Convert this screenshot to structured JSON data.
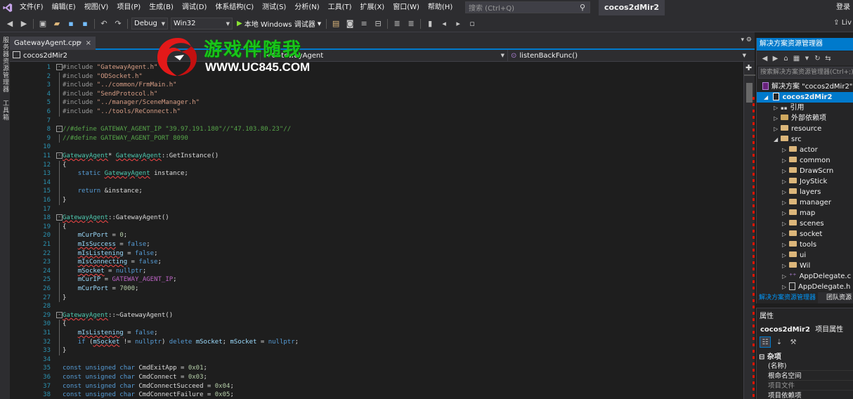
{
  "menubar": {
    "items": [
      "文件(F)",
      "编辑(E)",
      "视图(V)",
      "项目(P)",
      "生成(B)",
      "调试(D)",
      "体系结构(C)",
      "测试(S)",
      "分析(N)",
      "工具(T)",
      "扩展(X)",
      "窗口(W)",
      "帮助(H)"
    ],
    "search_placeholder": "搜索 (Ctrl+Q)",
    "window_title": "cocos2dMir2",
    "login": "登录"
  },
  "toolbar": {
    "config": "Debug",
    "platform": "Win32",
    "run_label": "本地 Windows 调试器",
    "live_share": "Liv"
  },
  "left_strip": {
    "tab1": "服务器资源管理器",
    "tab2": "工具箱"
  },
  "editor": {
    "tab_label": "GatewayAgent.cpp",
    "pin": "⊸",
    "close": "×",
    "nav_project": "cocos2dMir2",
    "nav_scope": "GatewayAgent",
    "nav_member": "listenBackFunc()",
    "lines": [
      {
        "n": "1",
        "fold": "-",
        "parts": [
          [
            "pp",
            "#include "
          ],
          [
            "str",
            "\"GatewayAgent.h\""
          ]
        ]
      },
      {
        "n": "2",
        "guide": true,
        "parts": [
          [
            "pp",
            "#include "
          ],
          [
            "str",
            "\"ODSocket.h\""
          ]
        ]
      },
      {
        "n": "3",
        "guide": true,
        "parts": [
          [
            "pp",
            "#include "
          ],
          [
            "str",
            "\"../common/FrmMain.h\""
          ]
        ]
      },
      {
        "n": "4",
        "guide": true,
        "parts": [
          [
            "pp",
            "#include "
          ],
          [
            "str",
            "\"SendProtocol.h\""
          ]
        ]
      },
      {
        "n": "5",
        "guide": true,
        "parts": [
          [
            "pp",
            "#include "
          ],
          [
            "str",
            "\"../manager/SceneManager.h\""
          ]
        ]
      },
      {
        "n": "6",
        "guide": true,
        "parts": [
          [
            "pp",
            "#include "
          ],
          [
            "str",
            "\"../tools/ReConnect.h\""
          ]
        ]
      },
      {
        "n": "7",
        "parts": []
      },
      {
        "n": "8",
        "fold": "-",
        "parts": [
          [
            "cm",
            "//#define GATEWAY_AGENT_IP \"39.97.191.180\"//\"47.103.80.23\"//"
          ]
        ]
      },
      {
        "n": "9",
        "guide": true,
        "parts": [
          [
            "cm",
            "//#define GATEWAY_AGENT_PORT 8090"
          ]
        ]
      },
      {
        "n": "10",
        "parts": []
      },
      {
        "n": "11",
        "fold": "-",
        "parts": [
          [
            "ty sq",
            "GatewayAgent"
          ],
          [
            "",
            "* "
          ],
          [
            "ty sq",
            "GatewayAgent"
          ],
          [
            "",
            "::GetInstance()"
          ]
        ]
      },
      {
        "n": "12",
        "guide": true,
        "parts": [
          [
            "",
            "{"
          ]
        ]
      },
      {
        "n": "13",
        "guide": true,
        "parts": [
          [
            "",
            "    "
          ],
          [
            "kw",
            "static "
          ],
          [
            "ty sq",
            "GatewayAgent"
          ],
          [
            "",
            " instance;"
          ]
        ]
      },
      {
        "n": "14",
        "guide": true,
        "parts": []
      },
      {
        "n": "15",
        "guide": true,
        "parts": [
          [
            "",
            "    "
          ],
          [
            "kw",
            "return "
          ],
          [
            "",
            "&instance;"
          ]
        ]
      },
      {
        "n": "16",
        "guide": true,
        "parts": [
          [
            "",
            "}"
          ]
        ]
      },
      {
        "n": "17",
        "parts": []
      },
      {
        "n": "18",
        "fold": "-",
        "parts": [
          [
            "ty sq",
            "GatewayAgent"
          ],
          [
            "",
            "::GatewayAgent()"
          ]
        ]
      },
      {
        "n": "19",
        "guide": true,
        "parts": [
          [
            "",
            "{"
          ]
        ]
      },
      {
        "n": "20",
        "guide": true,
        "parts": [
          [
            "",
            "    "
          ],
          [
            "vr",
            "mCurPort"
          ],
          [
            "",
            " = "
          ],
          [
            "num",
            "0"
          ],
          [
            "",
            ";"
          ]
        ]
      },
      {
        "n": "21",
        "guide": true,
        "parts": [
          [
            "",
            "    "
          ],
          [
            "vr sq",
            "mIsSuccess"
          ],
          [
            "",
            " = "
          ],
          [
            "kw",
            "false"
          ],
          [
            "",
            ";"
          ]
        ]
      },
      {
        "n": "22",
        "guide": true,
        "parts": [
          [
            "",
            "    "
          ],
          [
            "vr sq",
            "mIsListening"
          ],
          [
            "",
            " = "
          ],
          [
            "kw",
            "false"
          ],
          [
            "",
            ";"
          ]
        ]
      },
      {
        "n": "23",
        "guide": true,
        "parts": [
          [
            "",
            "    "
          ],
          [
            "vr sq",
            "mIsConnecting"
          ],
          [
            "",
            " = "
          ],
          [
            "kw",
            "false"
          ],
          [
            "",
            ";"
          ]
        ]
      },
      {
        "n": "24",
        "guide": true,
        "parts": [
          [
            "",
            "    "
          ],
          [
            "vr sq",
            "mSocket"
          ],
          [
            "",
            " = "
          ],
          [
            "kw",
            "nullptr"
          ],
          [
            "",
            ";"
          ]
        ]
      },
      {
        "n": "25",
        "guide": true,
        "parts": [
          [
            "",
            "    "
          ],
          [
            "vr",
            "mCurIP"
          ],
          [
            "",
            " = "
          ],
          [
            "mac",
            "GATEWAY_AGENT_IP"
          ],
          [
            "",
            ";"
          ]
        ]
      },
      {
        "n": "26",
        "guide": true,
        "parts": [
          [
            "",
            "    "
          ],
          [
            "vr",
            "mCurPort"
          ],
          [
            "",
            " = "
          ],
          [
            "num",
            "7000"
          ],
          [
            "",
            ";"
          ]
        ]
      },
      {
        "n": "27",
        "guide": true,
        "parts": [
          [
            "",
            "}"
          ]
        ]
      },
      {
        "n": "28",
        "parts": []
      },
      {
        "n": "29",
        "fold": "-",
        "parts": [
          [
            "ty sq",
            "GatewayAgent"
          ],
          [
            "",
            "::~GatewayAgent()"
          ]
        ]
      },
      {
        "n": "30",
        "guide": true,
        "parts": [
          [
            "",
            "{"
          ]
        ]
      },
      {
        "n": "31",
        "guide": true,
        "parts": [
          [
            "",
            "    "
          ],
          [
            "vr sq",
            "mIsListening"
          ],
          [
            "",
            " = "
          ],
          [
            "kw",
            "false"
          ],
          [
            "",
            ";"
          ]
        ]
      },
      {
        "n": "32",
        "guide": true,
        "parts": [
          [
            "",
            "    "
          ],
          [
            "kw",
            "if "
          ],
          [
            "",
            "("
          ],
          [
            "vr sq",
            "mSocket"
          ],
          [
            "",
            " != "
          ],
          [
            "kw",
            "nullptr"
          ],
          [
            "",
            ") "
          ],
          [
            "kw",
            "delete "
          ],
          [
            "vr",
            "mSocket"
          ],
          [
            "",
            "; "
          ],
          [
            "vr",
            "mSocket"
          ],
          [
            "",
            " = "
          ],
          [
            "kw",
            "nullptr"
          ],
          [
            "",
            ";"
          ]
        ]
      },
      {
        "n": "33",
        "guide": true,
        "parts": [
          [
            "",
            "}"
          ]
        ]
      },
      {
        "n": "34",
        "parts": []
      },
      {
        "n": "35",
        "parts": [
          [
            "kw",
            "const unsigned char "
          ],
          [
            "",
            "CmdExitApp = "
          ],
          [
            "num",
            "0x01"
          ],
          [
            "",
            ";"
          ]
        ]
      },
      {
        "n": "36",
        "parts": [
          [
            "kw",
            "const unsigned char "
          ],
          [
            "",
            "CmdConnect = "
          ],
          [
            "num",
            "0x03"
          ],
          [
            "",
            ";"
          ]
        ]
      },
      {
        "n": "37",
        "parts": [
          [
            "kw",
            "const unsigned char "
          ],
          [
            "",
            "CmdConnectSucceed = "
          ],
          [
            "num",
            "0x04"
          ],
          [
            "",
            ";"
          ]
        ]
      },
      {
        "n": "38",
        "parts": [
          [
            "kw",
            "const unsigned char "
          ],
          [
            "",
            "CmdConnectFailure = "
          ],
          [
            "num",
            "0x05"
          ],
          [
            "",
            ";"
          ]
        ]
      }
    ]
  },
  "watermark": {
    "title": "游戏伴随我",
    "url": "WWW.UC845.COM"
  },
  "solution_explorer": {
    "title": "解决方案资源管理器",
    "search_placeholder": "搜索解决方案资源管理器(Ctrl+;)",
    "solution_label": "解决方案 \"cocos2dMir2\"",
    "project_label": "cocos2dMir2",
    "items": [
      {
        "label": "引用",
        "indent": 2,
        "icon": "references-icon"
      },
      {
        "label": "外部依赖项",
        "indent": 2,
        "icon": "dependencies-icon"
      },
      {
        "label": "resource",
        "indent": 2,
        "icon": "folder-icon"
      },
      {
        "label": "src",
        "indent": 2,
        "icon": "folder-icon",
        "expanded": true
      },
      {
        "label": "actor",
        "indent": 3,
        "icon": "folder-icon"
      },
      {
        "label": "common",
        "indent": 3,
        "icon": "folder-icon"
      },
      {
        "label": "DrawScrn",
        "indent": 3,
        "icon": "folder-icon"
      },
      {
        "label": "JoyStick",
        "indent": 3,
        "icon": "folder-icon"
      },
      {
        "label": "layers",
        "indent": 3,
        "icon": "folder-icon"
      },
      {
        "label": "manager",
        "indent": 3,
        "icon": "folder-icon"
      },
      {
        "label": "map",
        "indent": 3,
        "icon": "folder-icon"
      },
      {
        "label": "scenes",
        "indent": 3,
        "icon": "folder-icon"
      },
      {
        "label": "socket",
        "indent": 3,
        "icon": "folder-icon"
      },
      {
        "label": "tools",
        "indent": 3,
        "icon": "folder-icon"
      },
      {
        "label": "ui",
        "indent": 3,
        "icon": "folder-icon"
      },
      {
        "label": "Wil",
        "indent": 3,
        "icon": "folder-icon"
      },
      {
        "label": "AppDelegate.c",
        "indent": 3,
        "icon": "cpp-file-icon"
      },
      {
        "label": "AppDelegate.h",
        "indent": 3,
        "icon": "header-file-icon"
      }
    ],
    "tab_active": "解决方案资源管理器",
    "tab_other": "团队资源"
  },
  "properties": {
    "title": "属性",
    "object_name": "cocos2dMir2",
    "object_type": "项目属性",
    "category": "杂项",
    "rows": [
      {
        "label": "(名称)",
        "dim": false
      },
      {
        "label": "根命名空间",
        "dim": false
      },
      {
        "label": "项目文件",
        "dim": true
      },
      {
        "label": "项目依赖项",
        "dim": false
      }
    ]
  },
  "colors": {
    "accent": "#007acc",
    "background": "#1e1e1e",
    "chrome": "#2d2d30",
    "keyword": "#569cd6",
    "string": "#d69d85",
    "comment": "#57a64a",
    "type": "#4ec9b0",
    "error_squiggle": "#f44747"
  }
}
